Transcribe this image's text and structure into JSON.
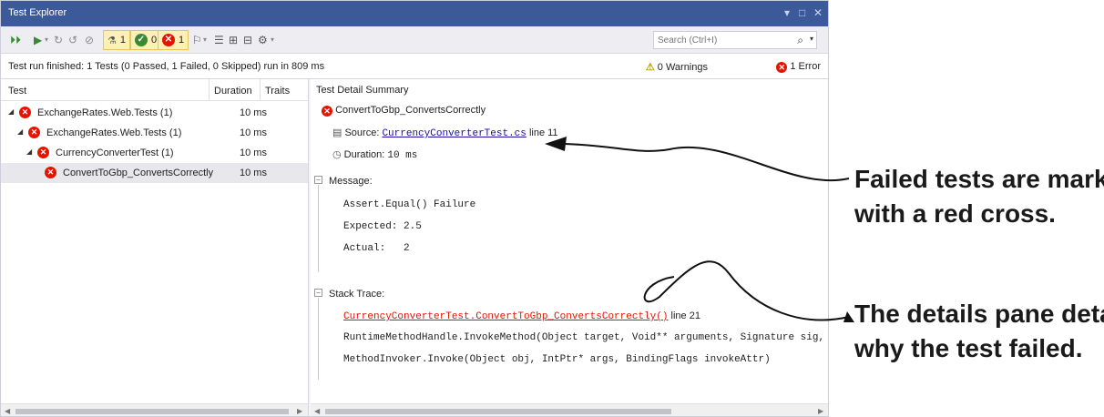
{
  "window": {
    "title": "Test Explorer",
    "controls": {
      "pin": "▾",
      "maximize": "□",
      "close": "✕"
    }
  },
  "toolbar": {
    "filters": {
      "all_count": "1",
      "passed_count": "0",
      "failed_count": "1"
    },
    "search_placeholder": "Search (Ctrl+I)"
  },
  "status": {
    "summary": "Test run finished: 1 Tests (0 Passed, 1 Failed, 0 Skipped) run in 809 ms",
    "warnings": "0 Warnings",
    "errors": "1 Error"
  },
  "test_list": {
    "columns": [
      "Test",
      "Duration",
      "Traits"
    ],
    "rows": [
      {
        "name": "ExchangeRates.Web.Tests (1)",
        "duration": "10 ms"
      },
      {
        "name": "ExchangeRates.Web.Tests (1)",
        "duration": "10 ms"
      },
      {
        "name": "CurrencyConverterTest (1)",
        "duration": "10 ms"
      },
      {
        "name": "ConvertToGbp_ConvertsCorrectly",
        "duration": "10 ms"
      }
    ]
  },
  "detail": {
    "header": "Test Detail Summary",
    "test_name": "ConvertToGbp_ConvertsCorrectly",
    "source_label": "Source:",
    "source_file": "CurrencyConverterTest.cs",
    "source_line": "line 11",
    "duration_label": "Duration:",
    "duration_value": "10 ms",
    "message_label": "Message:",
    "message_lines": [
      "Assert.Equal() Failure",
      "Expected: 2.5",
      "Actual:   2"
    ],
    "stack_label": "Stack Trace:",
    "stack_link": "CurrencyConverterTest.ConvertToGbp_ConvertsCorrectly()",
    "stack_line": "line 21",
    "stack_lines": [
      "RuntimeMethodHandle.InvokeMethod(Object target, Void** arguments, Signature sig, Boolean isCo",
      "MethodInvoker.Invoke(Object obj, IntPtr* args, BindingFlags invokeAttr)"
    ]
  },
  "annotations": {
    "first": [
      "Failed tests are marked",
      "with a red cross."
    ],
    "second": [
      "The details pane details",
      "why the test failed."
    ]
  },
  "colors": {
    "titlebar": "#3c5a9a",
    "error": "#e51400",
    "link": "#1a0dab",
    "pass": "#388a34"
  }
}
